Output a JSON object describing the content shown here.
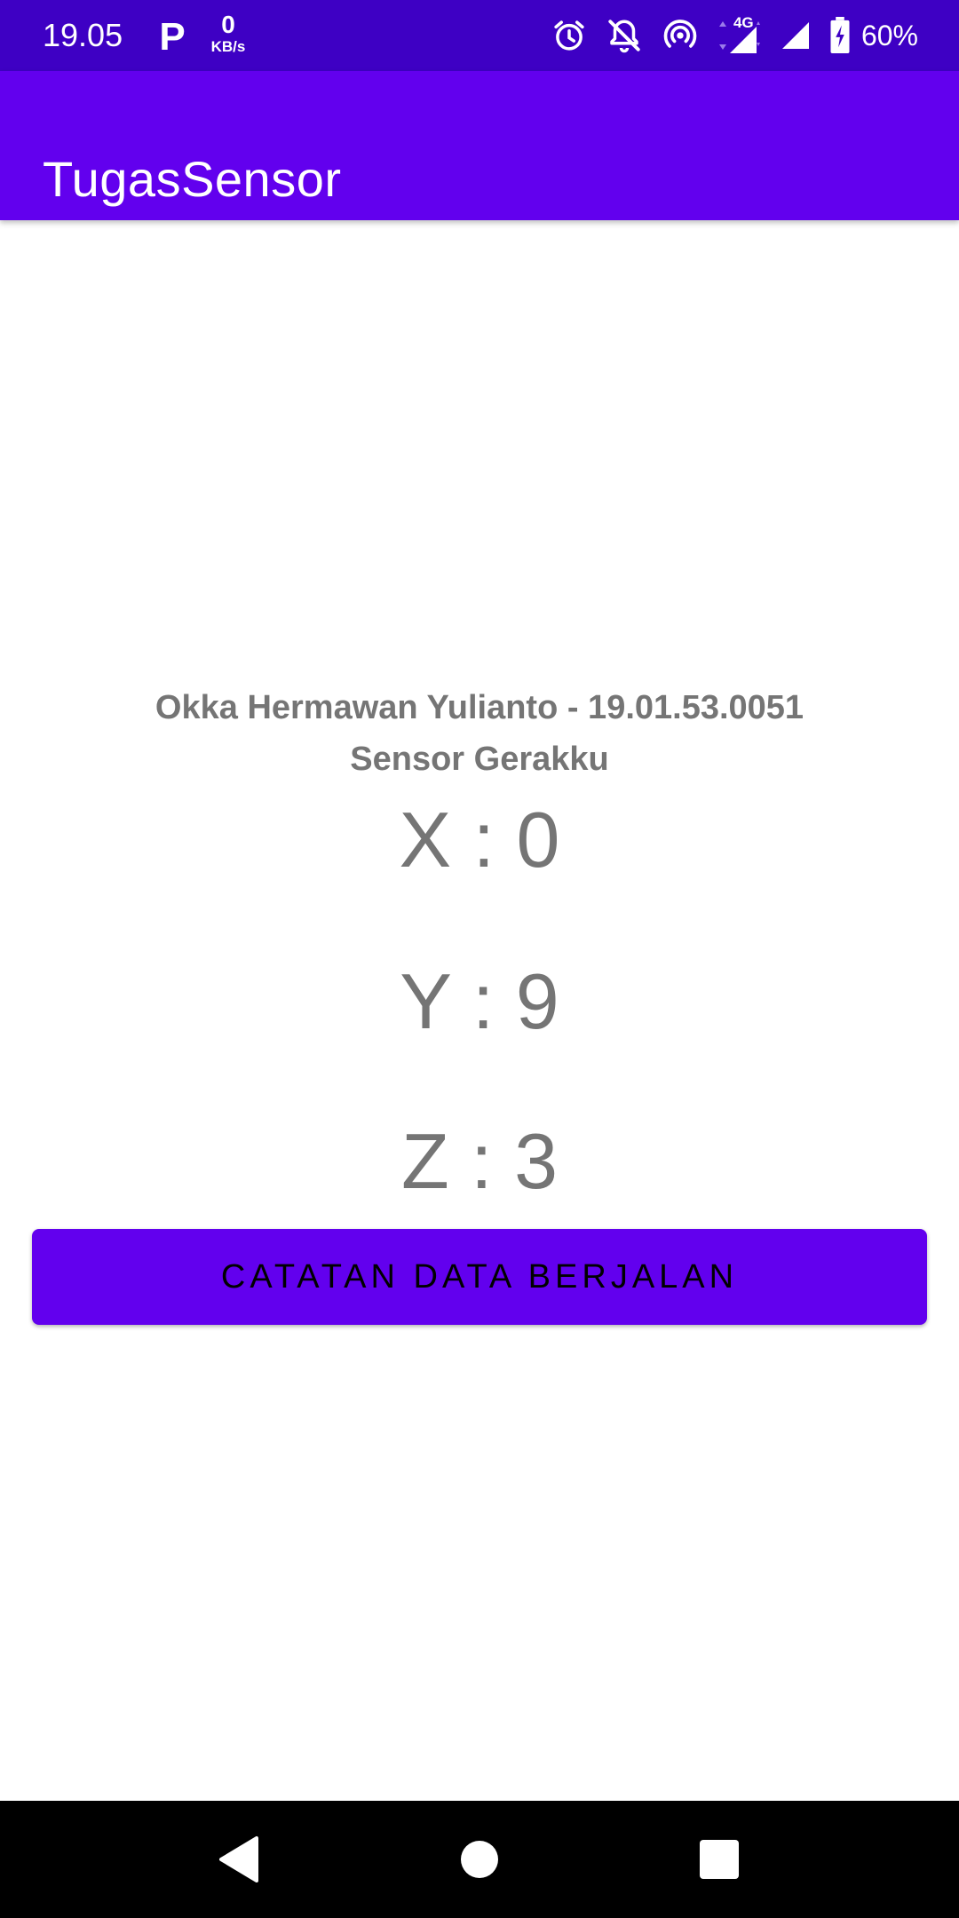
{
  "status_bar": {
    "time": "19.05",
    "parking_letter": "P",
    "data_rate_value": "0",
    "data_rate_unit": "KB/s",
    "network_type": "4G",
    "battery_percent": "60%",
    "background_color": "#3e00c4",
    "icons": [
      "alarm-icon",
      "notifications-off-icon",
      "hotspot-icon",
      "signal-4g-icon",
      "signal-icon",
      "battery-charging-icon"
    ]
  },
  "app_bar": {
    "title": "TugasSensor",
    "color": "#6200ee"
  },
  "main": {
    "student_line": "Okka Hermawan Yulianto - 19.01.53.0051",
    "sensor_title": "Sensor Gerakku",
    "x_reading": "X : 0",
    "y_reading": "Y : 9",
    "z_reading": "Z : 3",
    "button_label": "CATATAN DATA BERJALAN",
    "text_color": "#757575"
  },
  "nav_bar": {
    "icons": [
      "back-icon",
      "home-icon",
      "recents-icon"
    ]
  }
}
